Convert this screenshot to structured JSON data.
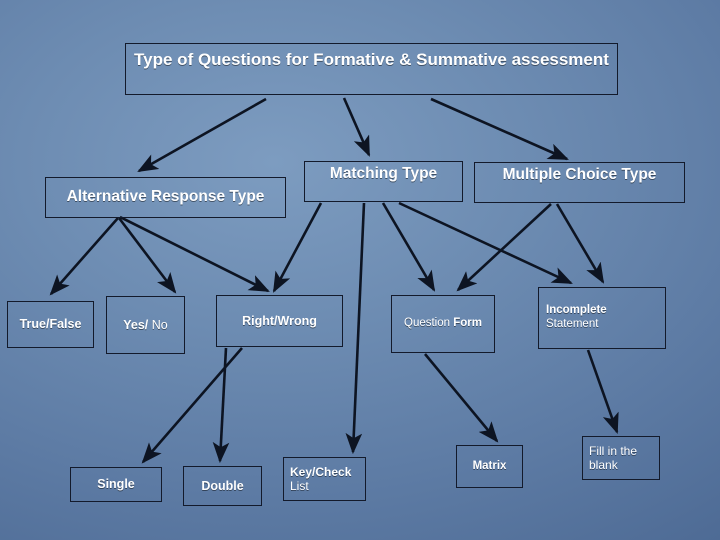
{
  "slide": {
    "title_box": {
      "text": "Type  of Questions for Formative & Summative assessment"
    },
    "background_color": "#5b7ba6",
    "box_border_color": "#131a2b",
    "text_color": "#ffffff"
  },
  "nodes": {
    "alternative_response": {
      "label": "Alternative Response Type"
    },
    "matching": {
      "label": "Matching  Type"
    },
    "multiple_choice": {
      "label": "Multiple Choice Type"
    },
    "true_false": {
      "label": "True/False"
    },
    "yes_no": {
      "bold": "Yes/",
      "regular": " No"
    },
    "right_wrong": {
      "label": "Right/Wrong"
    },
    "question_form": {
      "regular": "Question ",
      "bold": "Form"
    },
    "incomplete_statement": {
      "bold": "Incomplete",
      "regular": "Statement"
    },
    "single": {
      "label": "Single"
    },
    "double": {
      "label": "Double"
    },
    "key_check_list": {
      "bold": "Key/Check",
      "regular": "List"
    },
    "matrix": {
      "label": "Matrix"
    },
    "fill_in_the_blank": {
      "line1": "Fill in the",
      "line2": "blank"
    }
  }
}
